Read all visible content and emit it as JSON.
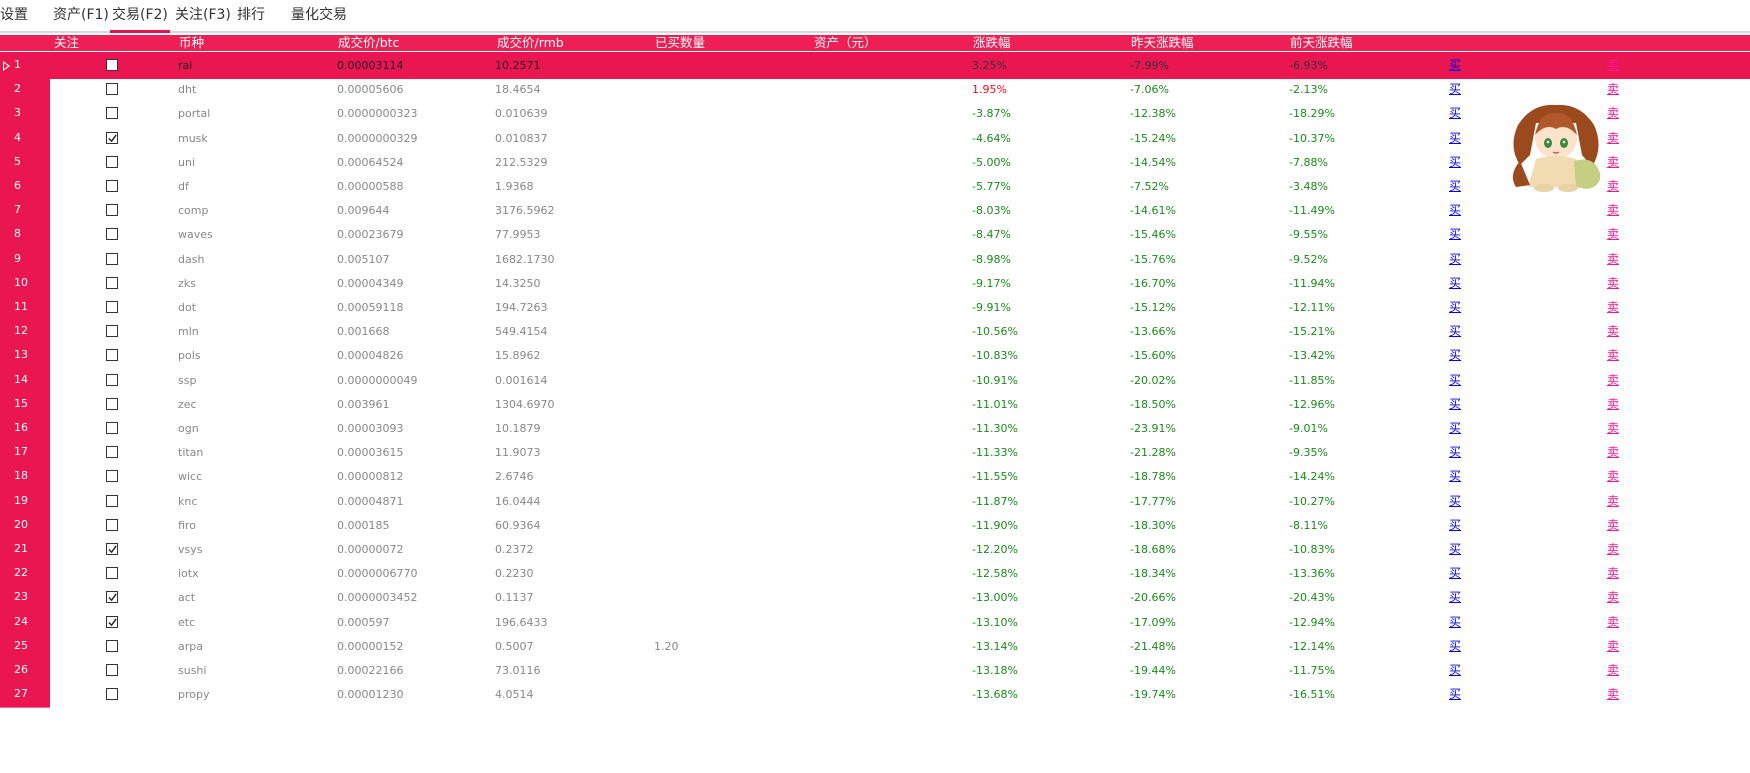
{
  "tabs": [
    {
      "label": "设置",
      "active": false
    },
    {
      "label": "资产(F1)",
      "active": false
    },
    {
      "label": "交易(F2)",
      "active": true
    },
    {
      "label": "关注(F3)",
      "active": false
    },
    {
      "label": "排行",
      "active": false
    },
    {
      "label": "量化交易",
      "active": false
    }
  ],
  "columns": {
    "watch": "关注",
    "coin": "币种",
    "price_btc": "成交价/btc",
    "price_rmb": "成交价/rmb",
    "bought": "已买数量",
    "assets": "资产（元）",
    "change": "涨跌幅",
    "change_yesterday": "昨天涨跌幅",
    "change_before": "前天涨跌幅"
  },
  "actions": {
    "buy": "买",
    "sell": "卖"
  },
  "colors": {
    "header": "#ee1f55",
    "selected_row": "#ea1651",
    "buy": "#0000ee",
    "sell": "#ff1493",
    "gain": "#e81123",
    "loss": "#1a8a1a"
  },
  "mascot_icon": "chibi-anime-girl-mascot",
  "rows": [
    {
      "no": "1",
      "watch": false,
      "coin": "rai",
      "btc": "0.00003114",
      "rmb": "10.2571",
      "bought": "",
      "assets": "",
      "change": "3.25%",
      "y1": "-7.99%",
      "y2": "-6.93%",
      "selected": true
    },
    {
      "no": "2",
      "watch": false,
      "coin": "dht",
      "btc": "0.00005606",
      "rmb": "18.4654",
      "bought": "",
      "assets": "",
      "change": "1.95%",
      "y1": "-7.06%",
      "y2": "-2.13%"
    },
    {
      "no": "3",
      "watch": false,
      "coin": "portal",
      "btc": "0.0000000323",
      "rmb": "0.010639",
      "bought": "",
      "assets": "",
      "change": "-3.87%",
      "y1": "-12.38%",
      "y2": "-18.29%"
    },
    {
      "no": "4",
      "watch": true,
      "coin": "musk",
      "btc": "0.0000000329",
      "rmb": "0.010837",
      "bought": "",
      "assets": "",
      "change": "-4.64%",
      "y1": "-15.24%",
      "y2": "-10.37%"
    },
    {
      "no": "5",
      "watch": false,
      "coin": "uni",
      "btc": "0.00064524",
      "rmb": "212.5329",
      "bought": "",
      "assets": "",
      "change": "-5.00%",
      "y1": "-14.54%",
      "y2": "-7.88%"
    },
    {
      "no": "6",
      "watch": false,
      "coin": "df",
      "btc": "0.00000588",
      "rmb": "1.9368",
      "bought": "",
      "assets": "",
      "change": "-5.77%",
      "y1": "-7.52%",
      "y2": "-3.48%"
    },
    {
      "no": "7",
      "watch": false,
      "coin": "comp",
      "btc": "0.009644",
      "rmb": "3176.5962",
      "bought": "",
      "assets": "",
      "change": "-8.03%",
      "y1": "-14.61%",
      "y2": "-11.49%"
    },
    {
      "no": "8",
      "watch": false,
      "coin": "waves",
      "btc": "0.00023679",
      "rmb": "77.9953",
      "bought": "",
      "assets": "",
      "change": "-8.47%",
      "y1": "-15.46%",
      "y2": "-9.55%"
    },
    {
      "no": "9",
      "watch": false,
      "coin": "dash",
      "btc": "0.005107",
      "rmb": "1682.1730",
      "bought": "",
      "assets": "",
      "change": "-8.98%",
      "y1": "-15.76%",
      "y2": "-9.52%"
    },
    {
      "no": "10",
      "watch": false,
      "coin": "zks",
      "btc": "0.00004349",
      "rmb": "14.3250",
      "bought": "",
      "assets": "",
      "change": "-9.17%",
      "y1": "-16.70%",
      "y2": "-11.94%"
    },
    {
      "no": "11",
      "watch": false,
      "coin": "dot",
      "btc": "0.00059118",
      "rmb": "194.7263",
      "bought": "",
      "assets": "",
      "change": "-9.91%",
      "y1": "-15.12%",
      "y2": "-12.11%"
    },
    {
      "no": "12",
      "watch": false,
      "coin": "mln",
      "btc": "0.001668",
      "rmb": "549.4154",
      "bought": "",
      "assets": "",
      "change": "-10.56%",
      "y1": "-13.66%",
      "y2": "-15.21%"
    },
    {
      "no": "13",
      "watch": false,
      "coin": "pols",
      "btc": "0.00004826",
      "rmb": "15.8962",
      "bought": "",
      "assets": "",
      "change": "-10.83%",
      "y1": "-15.60%",
      "y2": "-13.42%"
    },
    {
      "no": "14",
      "watch": false,
      "coin": "ssp",
      "btc": "0.0000000049",
      "rmb": "0.001614",
      "bought": "",
      "assets": "",
      "change": "-10.91%",
      "y1": "-20.02%",
      "y2": "-11.85%"
    },
    {
      "no": "15",
      "watch": false,
      "coin": "zec",
      "btc": "0.003961",
      "rmb": "1304.6970",
      "bought": "",
      "assets": "",
      "change": "-11.01%",
      "y1": "-18.50%",
      "y2": "-12.96%"
    },
    {
      "no": "16",
      "watch": false,
      "coin": "ogn",
      "btc": "0.00003093",
      "rmb": "10.1879",
      "bought": "",
      "assets": "",
      "change": "-11.30%",
      "y1": "-23.91%",
      "y2": "-9.01%"
    },
    {
      "no": "17",
      "watch": false,
      "coin": "titan",
      "btc": "0.00003615",
      "rmb": "11.9073",
      "bought": "",
      "assets": "",
      "change": "-11.33%",
      "y1": "-21.28%",
      "y2": "-9.35%"
    },
    {
      "no": "18",
      "watch": false,
      "coin": "wicc",
      "btc": "0.00000812",
      "rmb": "2.6746",
      "bought": "",
      "assets": "",
      "change": "-11.55%",
      "y1": "-18.78%",
      "y2": "-14.24%"
    },
    {
      "no": "19",
      "watch": false,
      "coin": "knc",
      "btc": "0.00004871",
      "rmb": "16.0444",
      "bought": "",
      "assets": "",
      "change": "-11.87%",
      "y1": "-17.77%",
      "y2": "-10.27%"
    },
    {
      "no": "20",
      "watch": false,
      "coin": "firo",
      "btc": "0.000185",
      "rmb": "60.9364",
      "bought": "",
      "assets": "",
      "change": "-11.90%",
      "y1": "-18.30%",
      "y2": "-8.11%"
    },
    {
      "no": "21",
      "watch": true,
      "coin": "vsys",
      "btc": "0.00000072",
      "rmb": "0.2372",
      "bought": "",
      "assets": "",
      "change": "-12.20%",
      "y1": "-18.68%",
      "y2": "-10.83%"
    },
    {
      "no": "22",
      "watch": false,
      "coin": "iotx",
      "btc": "0.0000006770",
      "rmb": "0.2230",
      "bought": "",
      "assets": "",
      "change": "-12.58%",
      "y1": "-18.34%",
      "y2": "-13.36%"
    },
    {
      "no": "23",
      "watch": true,
      "coin": "act",
      "btc": "0.0000003452",
      "rmb": "0.1137",
      "bought": "",
      "assets": "",
      "change": "-13.00%",
      "y1": "-20.66%",
      "y2": "-20.43%"
    },
    {
      "no": "24",
      "watch": true,
      "coin": "etc",
      "btc": "0.000597",
      "rmb": "196.6433",
      "bought": "",
      "assets": "",
      "change": "-13.10%",
      "y1": "-17.09%",
      "y2": "-12.94%"
    },
    {
      "no": "25",
      "watch": false,
      "coin": "arpa",
      "btc": "0.00000152",
      "rmb": "0.5007",
      "bought": "1.20",
      "assets": "",
      "change": "-13.14%",
      "y1": "-21.48%",
      "y2": "-12.14%"
    },
    {
      "no": "26",
      "watch": false,
      "coin": "sushi",
      "btc": "0.00022166",
      "rmb": "73.0116",
      "bought": "",
      "assets": "",
      "change": "-13.18%",
      "y1": "-19.44%",
      "y2": "-11.75%"
    },
    {
      "no": "27",
      "watch": false,
      "coin": "propy",
      "btc": "0.00001230",
      "rmb": "4.0514",
      "bought": "",
      "assets": "",
      "change": "-13.68%",
      "y1": "-19.74%",
      "y2": "-16.51%"
    }
  ]
}
